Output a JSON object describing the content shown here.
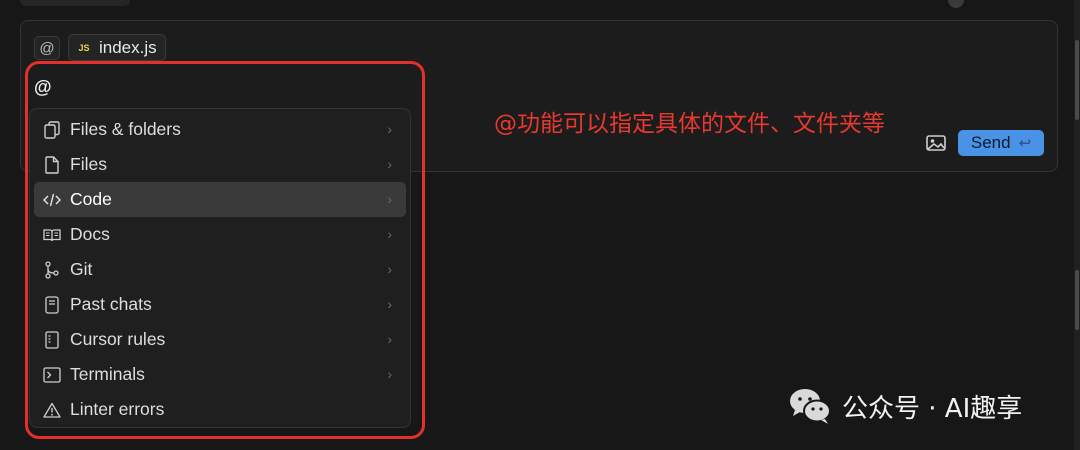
{
  "context_chips": {
    "at_symbol": "@",
    "file_badge": "JS",
    "file_name": "index.js"
  },
  "input": {
    "typed_text": "@"
  },
  "toolbar": {
    "image_icon": "image-icon",
    "send_label": "Send",
    "send_shortcut": "↩",
    "accent_color": "#4a92e6"
  },
  "annotation": {
    "text": "@功能可以指定具体的文件、文件夹等",
    "color": "#e8382f"
  },
  "menu": {
    "items": [
      {
        "label": "Files & folders",
        "icon": "files-folders-icon",
        "has_submenu": true,
        "selected": false
      },
      {
        "label": "Files",
        "icon": "file-icon",
        "has_submenu": true,
        "selected": false
      },
      {
        "label": "Code",
        "icon": "code-icon",
        "has_submenu": true,
        "selected": true
      },
      {
        "label": "Docs",
        "icon": "book-icon",
        "has_submenu": true,
        "selected": false
      },
      {
        "label": "Git",
        "icon": "git-branch-icon",
        "has_submenu": true,
        "selected": false
      },
      {
        "label": "Past chats",
        "icon": "chat-history-icon",
        "has_submenu": true,
        "selected": false
      },
      {
        "label": "Cursor rules",
        "icon": "rules-icon",
        "has_submenu": true,
        "selected": false
      },
      {
        "label": "Terminals",
        "icon": "terminal-icon",
        "has_submenu": true,
        "selected": false
      },
      {
        "label": "Linter errors",
        "icon": "warning-icon",
        "has_submenu": false,
        "selected": false
      }
    ]
  },
  "watermark": {
    "text": "公众号 · AI趣享"
  }
}
